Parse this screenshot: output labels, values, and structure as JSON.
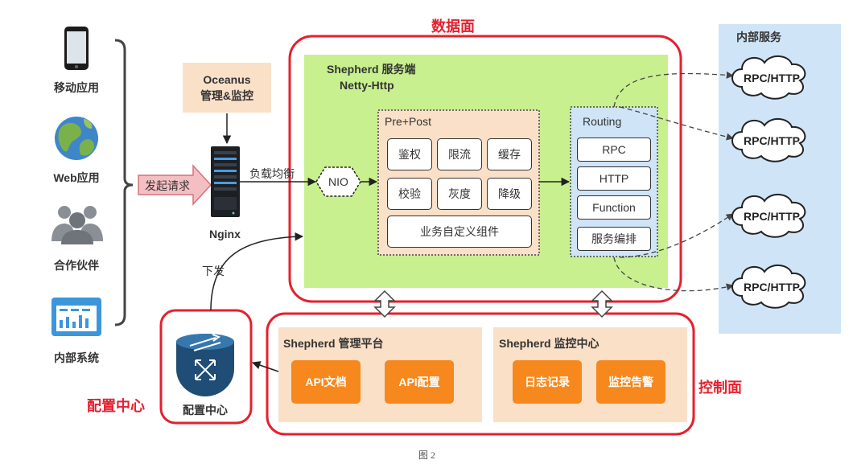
{
  "clients": [
    "移动应用",
    "Web应用",
    "合作伙伴",
    "内部系统"
  ],
  "request_label": "发起请求",
  "oceanus": {
    "line1": "Oceanus",
    "line2": "管理&监控"
  },
  "nginx_label": "Nginx",
  "lb_label": "负载均衡",
  "dispatch_label": "下发",
  "data_plane": {
    "title": "数据面",
    "server_line1": "Shepherd 服务端",
    "server_line2": "Netty-Http",
    "nio": "NIO",
    "prepost": {
      "title": "Pre+Post",
      "cells": [
        "鉴权",
        "限流",
        "缓存",
        "校验",
        "灰度",
        "降级"
      ],
      "custom": "业务自定义组件"
    },
    "routing": {
      "title": "Routing",
      "items": [
        "RPC",
        "HTTP",
        "Function",
        "服务编排"
      ]
    }
  },
  "internal": {
    "title": "内部服务",
    "clouds": [
      "RPC/HTTP",
      "RPC/HTTP",
      "RPC/HTTP",
      "RPC/HTTP"
    ]
  },
  "control_plane": {
    "title": "控制面",
    "mgmt": {
      "title": "Shepherd 管理平台",
      "buttons": [
        "API文档",
        "API配置"
      ]
    },
    "monitor": {
      "title": "Shepherd 监控中心",
      "buttons": [
        "日志记录",
        "监控告警"
      ]
    }
  },
  "config_center": {
    "outer_label": "配置中心",
    "inner_label": "配置中心"
  },
  "caption": "图 2"
}
